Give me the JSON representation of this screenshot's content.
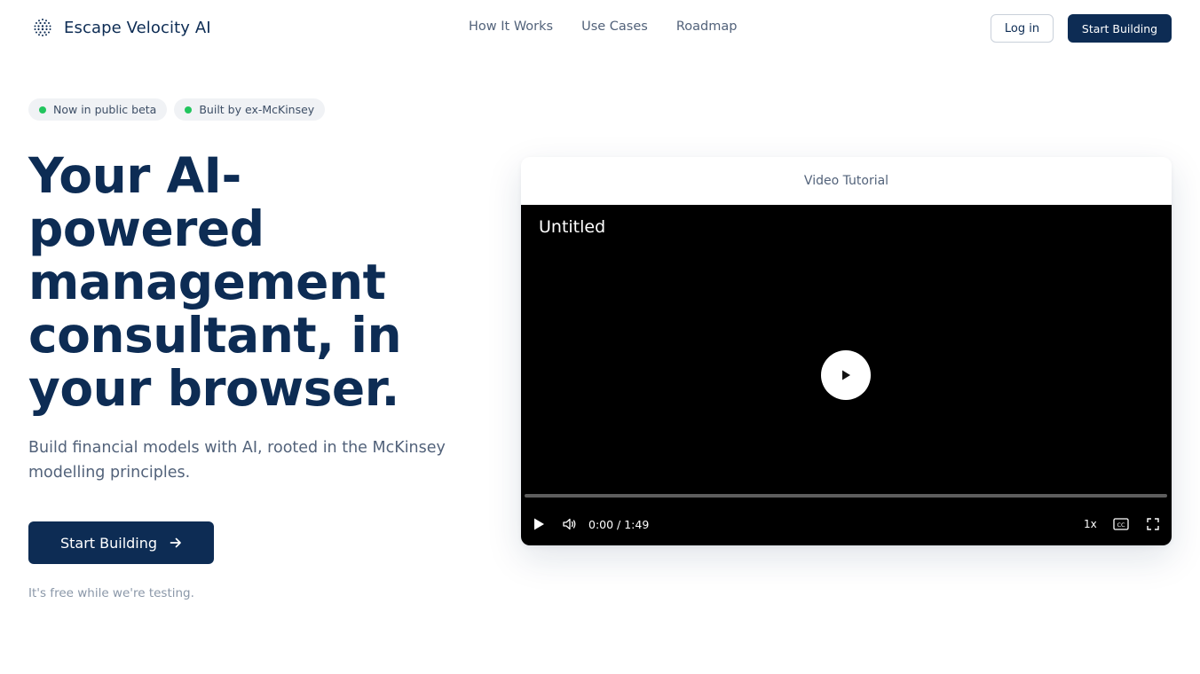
{
  "brand": {
    "name": "Escape Velocity AI",
    "logo_icon": "dotted-globe-icon"
  },
  "nav": {
    "items": [
      {
        "label": "How It Works"
      },
      {
        "label": "Use Cases"
      },
      {
        "label": "Roadmap"
      }
    ]
  },
  "header_actions": {
    "login_label": "Log in",
    "start_label": "Start Building"
  },
  "badges": [
    {
      "label": "Now in public beta"
    },
    {
      "label": "Built by ex-McKinsey"
    }
  ],
  "colors": {
    "primary": "#0d2c54",
    "badge_dot": "#22c55e",
    "muted": "#52627a"
  },
  "hero": {
    "title_lines": [
      "Your AI-",
      "powered",
      "management",
      "consultant, in",
      "your browser."
    ],
    "subtitle": "Build financial models with AI, rooted in the McKinsey modelling principles.",
    "cta_label": "Start Building",
    "cta_icon": "arrow-right-icon",
    "note": "It's free while we're testing."
  },
  "video": {
    "card_title": "Video Tutorial",
    "title": "Untitled",
    "time": "0:00 / 1:49",
    "speed": "1x",
    "progress": 0,
    "icons": [
      "play-icon",
      "volume-icon",
      "captions-icon",
      "fullscreen-icon"
    ]
  }
}
